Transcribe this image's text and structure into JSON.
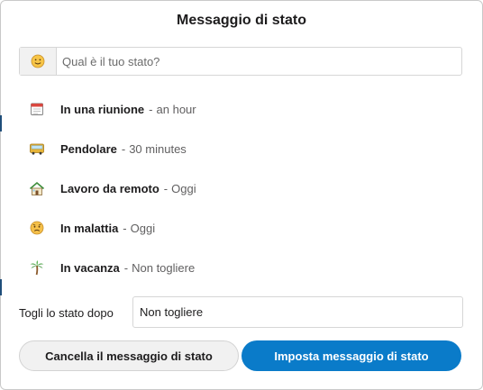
{
  "dialog": {
    "title": "Messaggio di stato",
    "search": {
      "placeholder": "Qual è il tuo stato?",
      "emoji_icon": "slightly-smiling-face-icon"
    },
    "presets": [
      {
        "icon": "calendar-icon",
        "name": "In una riunione",
        "separator": "-",
        "duration": "an hour"
      },
      {
        "icon": "bus-icon",
        "name": "Pendolare",
        "separator": "-",
        "duration": "30 minutes"
      },
      {
        "icon": "house-icon",
        "name": "Lavoro da remoto",
        "separator": "-",
        "duration": "Oggi"
      },
      {
        "icon": "sick-face-icon",
        "name": "In malattia",
        "separator": "-",
        "duration": "Oggi"
      },
      {
        "icon": "palm-tree-icon",
        "name": "In vacanza",
        "separator": "-",
        "duration": "Non togliere"
      }
    ],
    "clear_after": {
      "label": "Togli lo stato dopo",
      "value": "Non togliere"
    },
    "buttons": {
      "cancel": "Cancella il messaggio di stato",
      "submit": "Imposta messaggio di stato"
    },
    "colors": {
      "primary": "#0a7bc9",
      "secondary_bg": "#f1f1f1",
      "text": "#1d1c1d",
      "muted": "#616061"
    }
  }
}
